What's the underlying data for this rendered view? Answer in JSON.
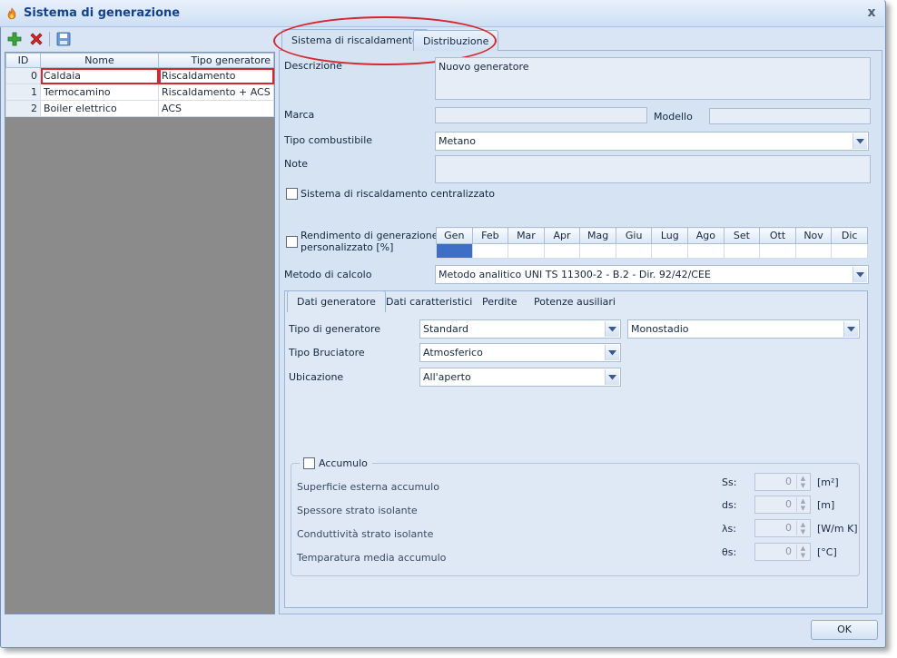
{
  "window": {
    "title": "Sistema di generazione",
    "close_label": "x"
  },
  "toolbar": {
    "add_icon": "plus-icon",
    "delete_icon": "delete-x-icon",
    "save_icon": "save-icon"
  },
  "grid": {
    "headers": [
      "ID",
      "Nome",
      "Tipo generatore"
    ],
    "rows": [
      {
        "id": "0",
        "nome": "Caldaia",
        "tipo": "Riscaldamento"
      },
      {
        "id": "1",
        "nome": "Termocamino",
        "tipo": "Riscaldamento + ACS"
      },
      {
        "id": "2",
        "nome": "Boiler elettrico",
        "tipo": "ACS"
      }
    ]
  },
  "tabs": [
    "Sistema di riscaldamento",
    "Distribuzione"
  ],
  "form": {
    "descrizione_label": "Descrizione",
    "descrizione_value": "Nuovo generatore",
    "marca_label": "Marca",
    "marca_value": "",
    "modello_label": "Modello",
    "modello_value": "",
    "tipo_combustibile_label": "Tipo combustibile",
    "tipo_combustibile_value": "Metano",
    "note_label": "Note",
    "note_value": "",
    "centralizzato_label": "Sistema di riscaldamento centralizzato",
    "rendimento_label_1": "Rendimento di generazione",
    "rendimento_label_2": "personalizzato [%]",
    "months": [
      "Gen",
      "Feb",
      "Mar",
      "Apr",
      "Mag",
      "Giu",
      "Lug",
      "Ago",
      "Set",
      "Ott",
      "Nov",
      "Dic"
    ],
    "metodo_label": "Metodo di calcolo",
    "metodo_value": "Metodo analitico UNI TS 11300-2 - B.2 - Dir. 92/42/CEE"
  },
  "inner_tabs": [
    "Dati generatore",
    "Dati caratteristici",
    "Perdite",
    "Potenze ausiliari"
  ],
  "generatore": {
    "tipo_label": "Tipo di generatore",
    "tipo_value": "Standard",
    "stadio_value": "Monostadio",
    "bruciatore_label": "Tipo Bruciatore",
    "bruciatore_value": "Atmosferico",
    "ubicazione_label": "Ubicazione",
    "ubicazione_value": "All'aperto"
  },
  "accumulo": {
    "label": "Accumulo",
    "rows": [
      {
        "label": "Superficie esterna accumulo",
        "symbol": "Ss:",
        "value": "0",
        "unit": "[m²]"
      },
      {
        "label": "Spessore strato isolante",
        "symbol": "ds:",
        "value": "0",
        "unit": "[m]"
      },
      {
        "label": "Conduttività strato isolante",
        "symbol": "λs:",
        "value": "0",
        "unit": "[W/m K]"
      },
      {
        "label": "Temparatura media accumulo",
        "symbol": "θs:",
        "value": "0",
        "unit": "[°C]"
      }
    ]
  },
  "footer": {
    "ok_label": "OK"
  },
  "colors": {
    "selection_outline": "#d6262e",
    "panel_bg": "#d6e3f3",
    "title_text": "#15428b"
  }
}
